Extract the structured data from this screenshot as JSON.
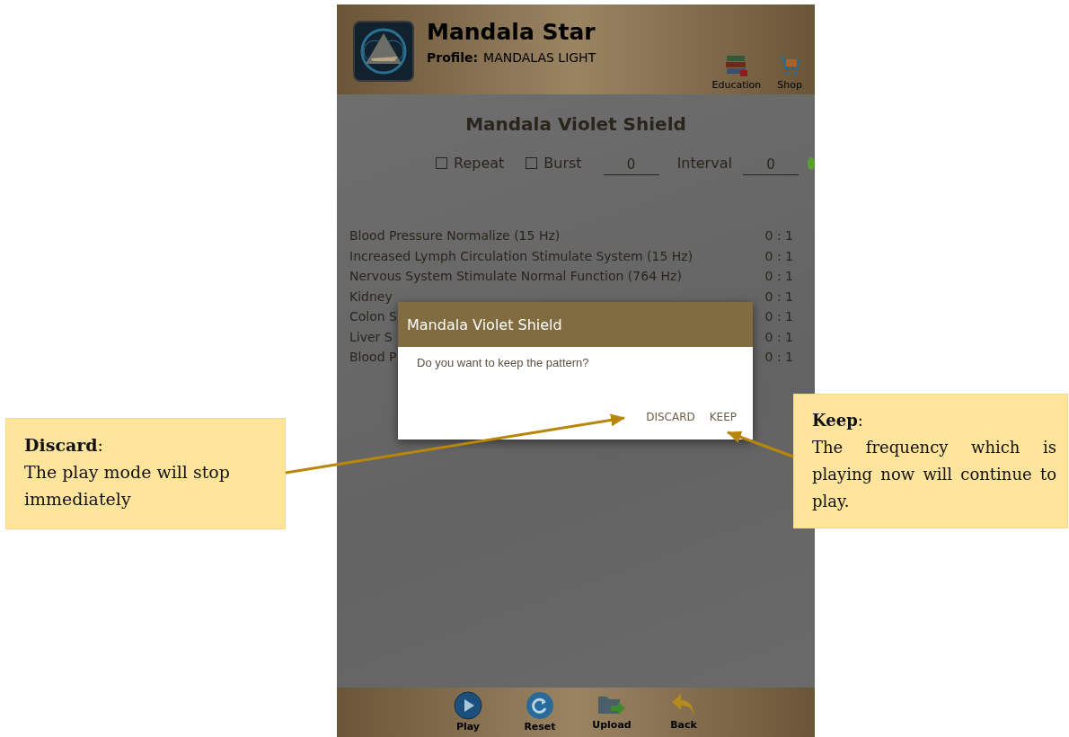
{
  "app": {
    "title": "Mandala Star",
    "profile_label": "Profile:",
    "profile": "MANDALAS LIGHT",
    "actions": [
      {
        "label": "Education"
      },
      {
        "label": "Shop"
      }
    ]
  },
  "program": {
    "title": "Mandala Violet Shield",
    "options": [
      {
        "label": "Repeat",
        "checked": false
      },
      {
        "label": "Burst",
        "checked": false
      }
    ],
    "burst_value": "0",
    "interval_label": "Interval",
    "interval_value": "0"
  },
  "frequencies": [
    {
      "name": "Blood Pressure Normalize (15 Hz)",
      "ratio": "0 : 1"
    },
    {
      "name": "Increased Lymph Circulation Stimulate System (15 Hz)",
      "ratio": "0 : 1"
    },
    {
      "name": "Nervous System Stimulate Normal Function (764 Hz)",
      "ratio": "0 : 1"
    },
    {
      "name": "Kidney",
      "ratio": "0 : 1"
    },
    {
      "name": "Colon S",
      "ratio": "0 : 1"
    },
    {
      "name": "Liver S",
      "ratio": "0 : 1"
    },
    {
      "name": "Blood P",
      "ratio": "0 : 1"
    }
  ],
  "dialog": {
    "title": "Mandala Violet Shield",
    "message": "Do you want to keep the pattern?",
    "buttons": [
      "DISCARD",
      "KEEP"
    ]
  },
  "toolbar": [
    {
      "label": "Play"
    },
    {
      "label": "Reset"
    },
    {
      "label": "Upload"
    },
    {
      "label": "Back"
    }
  ],
  "callouts": [
    {
      "heading": "**Discard**:",
      "text": "The play mode will stop immediately"
    },
    {
      "heading": "**Keep**:",
      "text": "The frequency which is playing now will continue to play."
    }
  ]
}
